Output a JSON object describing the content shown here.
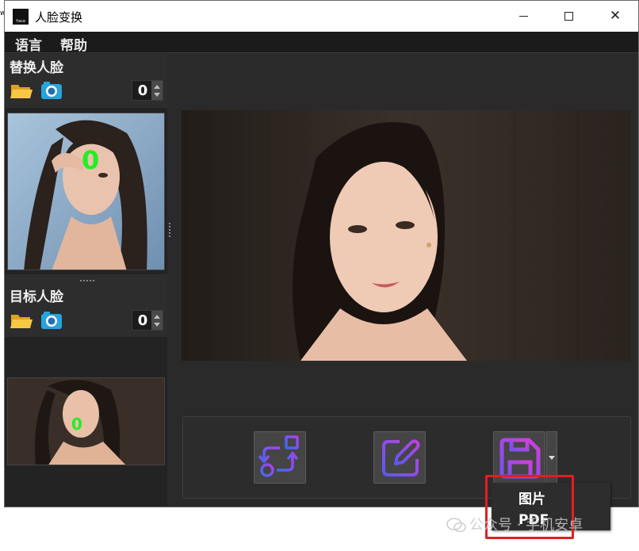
{
  "window": {
    "title": "人脸变换",
    "app_icon_text": "face",
    "controls": {
      "minimize": "minimize",
      "maximize": "maximize",
      "close": "✕"
    }
  },
  "menu": {
    "items": [
      {
        "label": "语言"
      },
      {
        "label": "帮助"
      }
    ]
  },
  "sidebar": {
    "replace_face": {
      "title": "替换人脸",
      "count": "0",
      "marker": "0"
    },
    "target_face": {
      "title": "目标人脸",
      "count": "0",
      "marker": "0"
    }
  },
  "toolbar": {
    "buttons": [
      {
        "name": "swap-faces-button",
        "icon": "swap-arrows-icon"
      },
      {
        "name": "edit-button",
        "icon": "edit-pen-icon"
      },
      {
        "name": "save-button",
        "icon": "floppy-disk-icon"
      }
    ]
  },
  "save_menu": {
    "items": [
      {
        "label": "图片"
      },
      {
        "label": "PDF"
      }
    ]
  },
  "watermark": {
    "text": "公众号 · 手机安卓"
  },
  "colors": {
    "window_bg": "#2a2a2a",
    "menubar_bg": "#1b1b1b",
    "marker_green": "#22ee22",
    "highlight_red": "#e02020",
    "icon_blue": "#3a6cf0",
    "icon_purple": "#b040f0"
  }
}
